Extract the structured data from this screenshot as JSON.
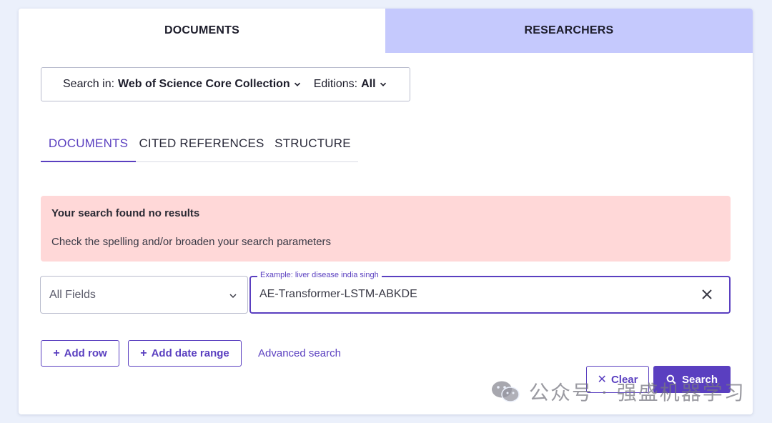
{
  "top_tabs": [
    {
      "label": "DOCUMENTS",
      "active": true
    },
    {
      "label": "RESEARCHERS",
      "active": false
    }
  ],
  "search_scope": {
    "search_in_label": "Search in:",
    "search_in_value": "Web of Science Core Collection",
    "editions_label": "Editions:",
    "editions_value": "All"
  },
  "sub_tabs": [
    {
      "label": "DOCUMENTS",
      "active": true
    },
    {
      "label": "CITED REFERENCES",
      "active": false
    },
    {
      "label": "STRUCTURE",
      "active": false
    }
  ],
  "alert": {
    "title": "Your search found no results",
    "message": "Check the spelling and/or broaden your search parameters"
  },
  "query_row": {
    "field": "All Fields",
    "legend": "Example: liver disease india singh",
    "value": "AE-Transformer-LSTM-ABKDE"
  },
  "actions": {
    "add_row": "Add row",
    "add_date_range": "Add date range",
    "advanced_search": "Advanced search",
    "clear": "Clear",
    "search": "Search"
  },
  "watermark": {
    "text": "公众号 · 强盛机器学习"
  },
  "colors": {
    "accent": "#5a3fc0",
    "inactive_tab": "#c5c9fd",
    "alert_bg": "#ffd8d8",
    "page_bg": "#ebf0fb"
  }
}
